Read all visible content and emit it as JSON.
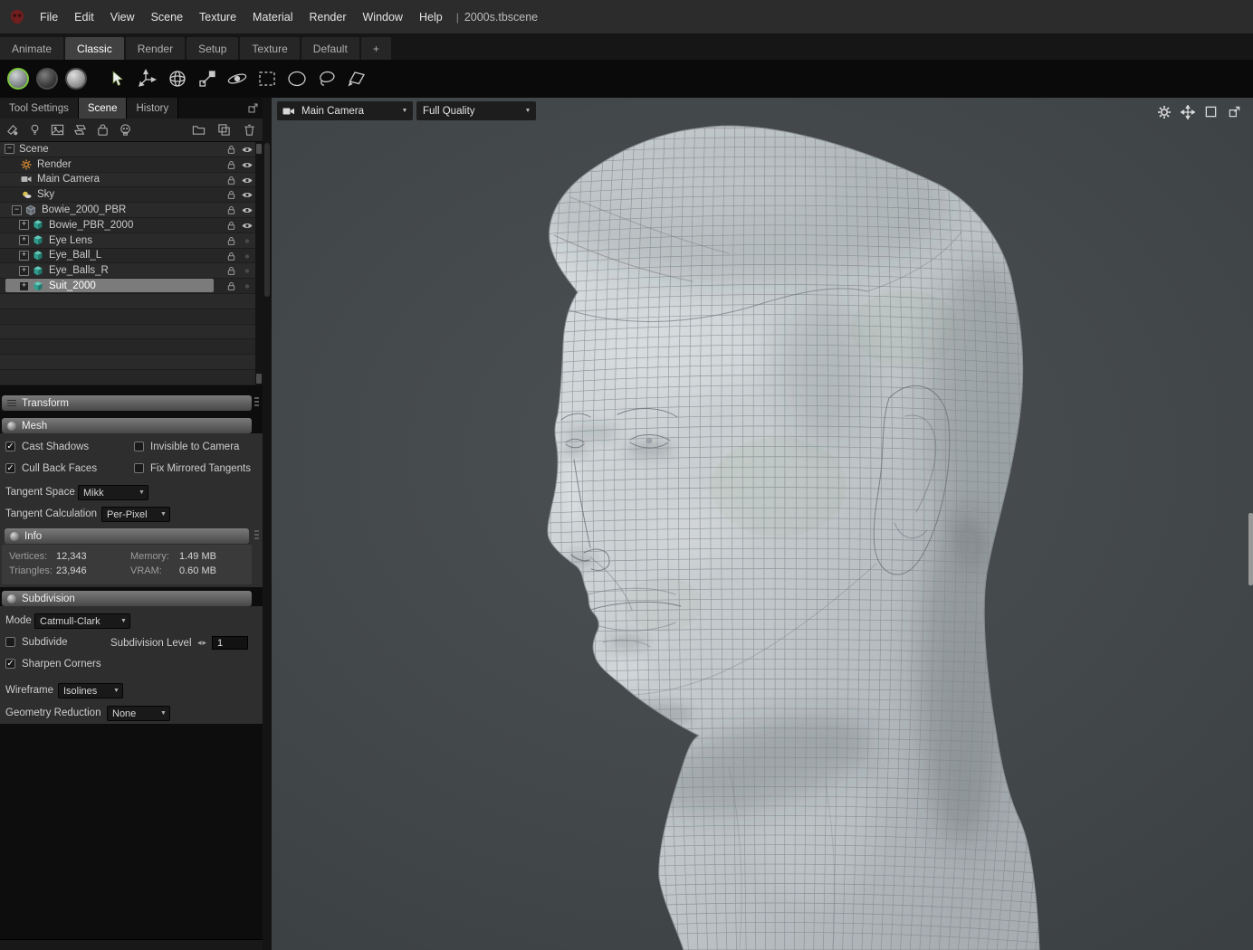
{
  "titlebar": {
    "menu_items": [
      "File",
      "Edit",
      "View",
      "Scene",
      "Texture",
      "Material",
      "Render",
      "Window",
      "Help"
    ],
    "separator": "|",
    "filename": "2000s.tbscene"
  },
  "workspace_tabs": [
    {
      "label": "Animate",
      "active": false
    },
    {
      "label": "Classic",
      "active": true
    },
    {
      "label": "Render",
      "active": false
    },
    {
      "label": "Setup",
      "active": false
    },
    {
      "label": "Texture",
      "active": false
    },
    {
      "label": "Default",
      "active": false
    },
    {
      "label": "+",
      "active": false
    }
  ],
  "toolbar": {
    "shade_modes": [
      "shaded-sphere",
      "dark-sphere",
      "matcap-sphere"
    ],
    "tools": [
      "select-cursor",
      "translate-tool",
      "rotate-tool",
      "scale-tool",
      "pivot-tool",
      "marquee-select",
      "ellipse-select",
      "lasso-select",
      "polygon-select"
    ]
  },
  "left_panel": {
    "tabs": [
      {
        "label": "Tool Settings",
        "active": false
      },
      {
        "label": "Scene",
        "active": true
      },
      {
        "label": "History",
        "active": false
      }
    ],
    "icon_row": [
      "add-light-icon",
      "bulb-icon",
      "sky-icon",
      "shadow-catcher-icon",
      "bag-icon",
      "skull-icon",
      "folder-icon",
      "duplicate-icon",
      "delete-icon"
    ],
    "tree": [
      {
        "label": "Scene",
        "depth": 0,
        "expander": "minus",
        "icon": "none",
        "visible": true,
        "selected": false
      },
      {
        "label": "Render",
        "depth": 1,
        "expander": null,
        "icon": "render",
        "visible": true,
        "selected": false
      },
      {
        "label": "Main Camera",
        "depth": 1,
        "expander": null,
        "icon": "camera",
        "visible": true,
        "selected": false
      },
      {
        "label": "Sky",
        "depth": 1,
        "expander": null,
        "icon": "sky",
        "visible": true,
        "selected": false
      },
      {
        "label": "Bowie_2000_PBR",
        "depth": 1,
        "expander": "minus",
        "icon": "group",
        "visible": true,
        "selected": false
      },
      {
        "label": "Bowie_PBR_2000",
        "depth": 2,
        "expander": "plus",
        "icon": "mesh",
        "visible": true,
        "selected": false
      },
      {
        "label": "Eye Lens",
        "depth": 2,
        "expander": "plus",
        "icon": "mesh",
        "visible": false,
        "selected": false
      },
      {
        "label": "Eye_Ball_L",
        "depth": 2,
        "expander": "plus",
        "icon": "mesh",
        "visible": false,
        "selected": false
      },
      {
        "label": "Eye_Balls_R",
        "depth": 2,
        "expander": "plus",
        "icon": "mesh",
        "visible": false,
        "selected": false
      },
      {
        "label": "Suit_2000",
        "depth": 2,
        "expander": "plus",
        "icon": "mesh",
        "visible": false,
        "selected": true
      }
    ],
    "transform": {
      "label": "Transform"
    },
    "mesh": {
      "label": "Mesh",
      "checkboxes": [
        {
          "label": "Cast Shadows",
          "checked": true
        },
        {
          "label": "Invisible to Camera",
          "checked": false
        },
        {
          "label": "Cull Back Faces",
          "checked": true
        },
        {
          "label": "Fix Mirrored Tangents",
          "checked": false
        }
      ],
      "tangent_space": {
        "label": "Tangent Space",
        "value": "Mikk"
      },
      "tangent_calculation": {
        "label": "Tangent Calculation",
        "value": "Per-Pixel"
      }
    },
    "info": {
      "label": "Info",
      "stats": [
        {
          "label": "Vertices:",
          "value": "12,343"
        },
        {
          "label": "Memory:",
          "value": "1.49 MB"
        },
        {
          "label": "Triangles:",
          "value": "23,946"
        },
        {
          "label": "VRAM:",
          "value": "0.60 MB"
        }
      ]
    },
    "subdivision": {
      "label": "Subdivision",
      "mode": {
        "label": "Mode",
        "value": "Catmull-Clark"
      },
      "subdivide": {
        "label": "Subdivide",
        "checked": false
      },
      "level": {
        "label": "Subdivision Level",
        "value": "1"
      },
      "sharpen": {
        "label": "Sharpen Corners",
        "checked": true
      },
      "wireframe": {
        "label": "Wireframe",
        "value": "Isolines"
      },
      "geometry_reduction": {
        "label": "Geometry Reduction",
        "value": "None"
      }
    }
  },
  "viewport": {
    "camera": {
      "value": "Main Camera"
    },
    "quality": {
      "value": "Full Quality"
    },
    "icons": [
      "gear-icon",
      "pan-icon",
      "frame-icon",
      "popout-icon"
    ],
    "model": "wireframe-head"
  }
}
